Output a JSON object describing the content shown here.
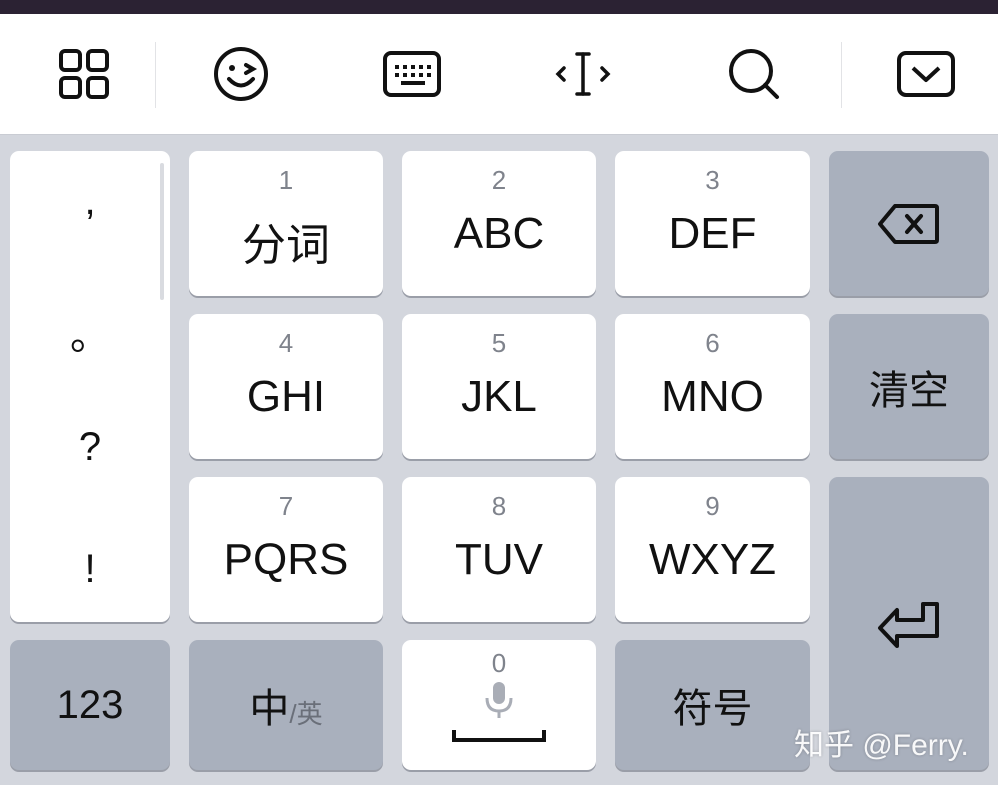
{
  "toolbar": {
    "icons": [
      "grid-icon",
      "emoji-wink-icon",
      "keyboard-icon",
      "cursor-move-icon",
      "search-icon",
      "collapse-keyboard-icon"
    ]
  },
  "punctuation": [
    ",",
    "。",
    "?",
    "!"
  ],
  "keys": [
    {
      "digit": "1",
      "letters": "分词"
    },
    {
      "digit": "2",
      "letters": "ABC"
    },
    {
      "digit": "3",
      "letters": "DEF"
    },
    {
      "digit": "4",
      "letters": "GHI"
    },
    {
      "digit": "5",
      "letters": "JKL"
    },
    {
      "digit": "6",
      "letters": "MNO"
    },
    {
      "digit": "7",
      "letters": "PQRS"
    },
    {
      "digit": "8",
      "letters": "TUV"
    },
    {
      "digit": "9",
      "letters": "WXYZ"
    }
  ],
  "right_column": {
    "clear_label": "清空"
  },
  "bottom_row": {
    "numeric_label": "123",
    "lang_primary": "中",
    "lang_secondary": "/英",
    "space_digit": "0",
    "symbols_label": "符号"
  },
  "watermark": "知乎 @Ferry.",
  "colors": {
    "white_key": "#ffffff",
    "gray_key": "#a9b0bd",
    "background": "#d3d6dd"
  }
}
